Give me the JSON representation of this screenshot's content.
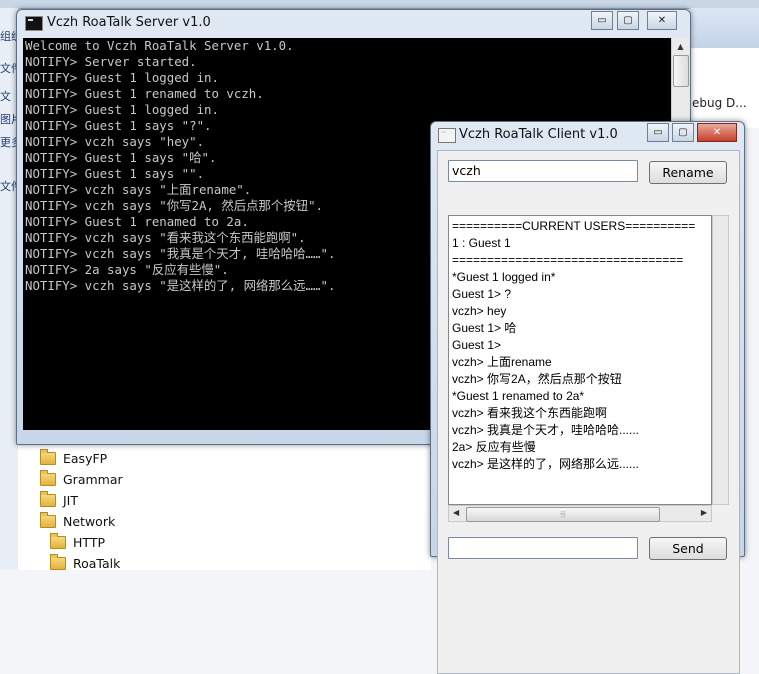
{
  "background": {
    "side_labels": [
      "组织",
      "文件夹",
      "文",
      "图片",
      "更多",
      "文件夹"
    ],
    "right_text": "ebug D...",
    "tree_items": [
      "EasyFP",
      "Grammar",
      "JIT",
      "Network",
      "HTTP",
      "RoaTalk"
    ]
  },
  "server": {
    "title": "Vczh RoaTalk Server v1.0",
    "lines": [
      "Welcome to Vczh RoaTalk Server v1.0.",
      "NOTIFY> Server started.",
      "NOTIFY> Guest 1 logged in.",
      "NOTIFY> Guest 1 renamed to vczh.",
      "NOTIFY> Guest 1 logged in.",
      "NOTIFY> Guest 1 says \"?\".",
      "NOTIFY> vczh says \"hey\".",
      "NOTIFY> Guest 1 says \"哈\".",
      "NOTIFY> Guest 1 says \"\".",
      "NOTIFY> vczh says \"上面rename\".",
      "NOTIFY> vczh says \"你写2A, 然后点那个按钮\".",
      "NOTIFY> Guest 1 renamed to 2a.",
      "NOTIFY> vczh says \"看来我这个东西能跑啊\".",
      "NOTIFY> vczh says \"我真是个天才, 哇哈哈哈……\".",
      "NOTIFY> 2a says \"反应有些慢\".",
      "NOTIFY> vczh says \"是这样的了, 网络那么远……\"."
    ]
  },
  "client": {
    "title": "Vczh RoaTalk Client v1.0",
    "name_value": "vczh",
    "rename_label": "Rename",
    "send_label": "Send",
    "message_value": "",
    "chat_lines": [
      "==========CURRENT USERS==========",
      "1 : Guest 1",
      "=================================",
      "*Guest 1 logged in*",
      "Guest 1> ?",
      "vczh> hey",
      "Guest 1> 哈",
      "Guest 1>",
      "vczh> 上面rename",
      "vczh> 你写2A，然后点那个按钮",
      "*Guest 1 renamed to 2a*",
      "vczh> 看来我这个东西能跑啊",
      "vczh> 我真是个天才，哇哈哈哈......",
      "2a> 反应有些慢",
      "vczh> 是这样的了，网络那么远......"
    ]
  },
  "caption_buttons": {
    "minimize": "▭",
    "maximize": "▢",
    "close": "✕"
  },
  "icons": [
    "minimize-icon",
    "maximize-icon",
    "close-icon",
    "folder-icon",
    "console-app-icon",
    "scroll-up-icon",
    "scroll-down-icon",
    "scroll-left-icon",
    "scroll-right-icon"
  ]
}
